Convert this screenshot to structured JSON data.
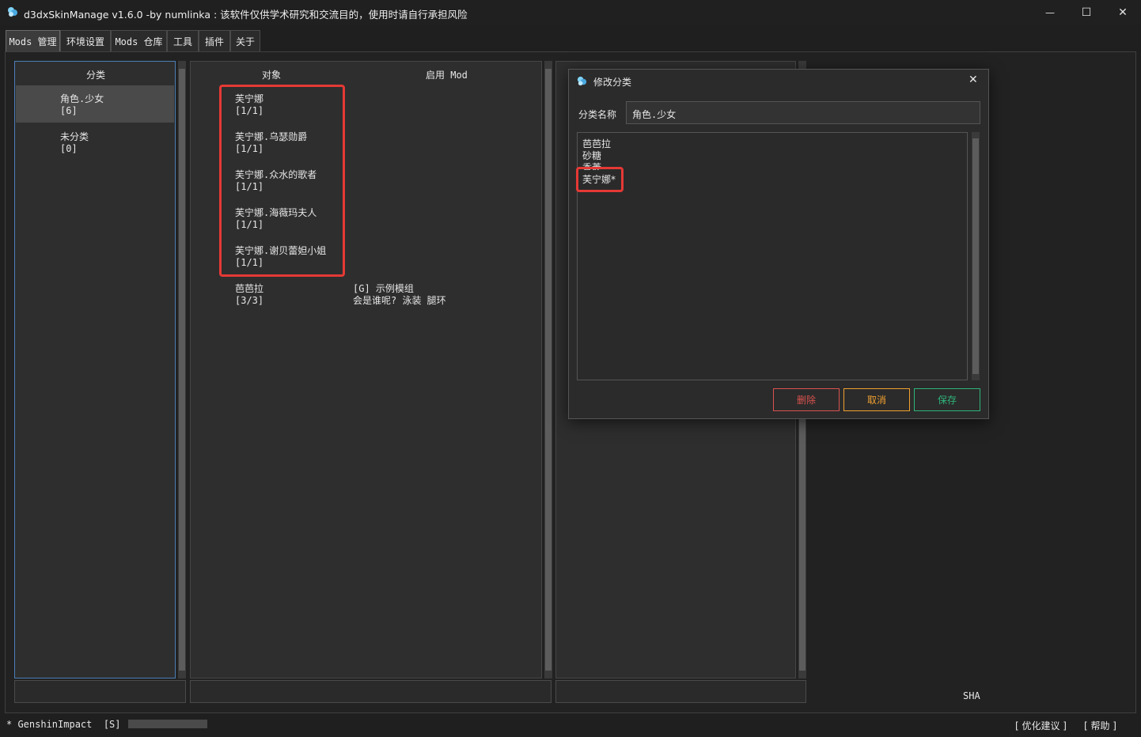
{
  "window": {
    "title": "d3dxSkinManage v1.6.0 -by numlinka : 该软件仅供学术研究和交流目的，使用时请自行承担风险",
    "minimize_glyph": "—",
    "maximize_glyph": "☐",
    "close_glyph": "✕"
  },
  "tabs": [
    {
      "label": "Mods 管理"
    },
    {
      "label": "环境设置"
    },
    {
      "label": "Mods 仓库"
    },
    {
      "label": "工具"
    },
    {
      "label": "插件"
    },
    {
      "label": "关于"
    }
  ],
  "category_panel": {
    "header": "分类",
    "items": [
      {
        "name": "角色.少女",
        "count": "[6]"
      },
      {
        "name": "未分类",
        "count": "[0]"
      }
    ]
  },
  "object_panel": {
    "header_object": "对象",
    "header_enabled": "启用 Mod",
    "items": [
      {
        "name": "芙宁娜",
        "count": "[1/1]"
      },
      {
        "name": "芙宁娜.乌瑟勋爵",
        "count": "[1/1]"
      },
      {
        "name": "芙宁娜.众水的歌者",
        "count": "[1/1]"
      },
      {
        "name": "芙宁娜.海薇玛夫人",
        "count": "[1/1]"
      },
      {
        "name": "芙宁娜.谢贝蕾妲小姐",
        "count": "[1/1]"
      },
      {
        "name": "芭芭拉",
        "count": "[3/3]"
      }
    ],
    "enabled_mod": {
      "line1": "[G] 示例模组",
      "line2": "会是谁呢? 泳装 腿环"
    }
  },
  "sha_label": "SHA",
  "dialog": {
    "title": "修改分类",
    "close_glyph": "✕",
    "field_label": "分类名称",
    "field_value": "角色.少女",
    "list_lines": [
      "芭芭拉",
      "砂糖",
      "香菱",
      "芙宁娜*"
    ],
    "delete_label": "删除",
    "cancel_label": "取消",
    "save_label": "保存",
    "colors": {
      "delete": "#d9534f",
      "cancel": "#f0a030",
      "save": "#2fb37a"
    }
  },
  "status": {
    "left": "* GenshinImpact  [S]  -",
    "suggest": "[ 优化建议 ]",
    "help": "[ 帮助 ]"
  }
}
